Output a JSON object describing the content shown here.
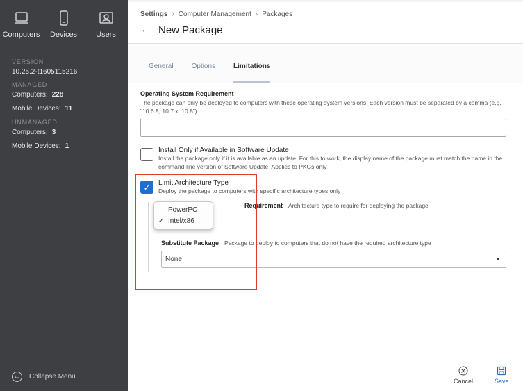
{
  "sidebar": {
    "nav": [
      {
        "label": "Computers",
        "icon": "laptop-icon"
      },
      {
        "label": "Devices",
        "icon": "phone-icon"
      },
      {
        "label": "Users",
        "icon": "user-id-icon"
      }
    ],
    "version_heading": "VERSION",
    "version": "10.25.2-t1605115216",
    "managed_heading": "MANAGED",
    "managed": [
      {
        "label": "Computers:",
        "count": "228"
      },
      {
        "label": "Mobile Devices:",
        "count": "11"
      }
    ],
    "unmanaged_heading": "UNMANAGED",
    "unmanaged": [
      {
        "label": "Computers:",
        "count": "3"
      },
      {
        "label": "Mobile Devices:",
        "count": "1"
      }
    ],
    "collapse_label": "Collapse Menu"
  },
  "header": {
    "breadcrumb": [
      "Settings",
      "Computer Management",
      "Packages"
    ],
    "title": "New Package"
  },
  "tabs": [
    "General",
    "Options",
    "Limitations"
  ],
  "active_tab": "Limitations",
  "os_requirement": {
    "label": "Operating System Requirement",
    "help": "The package can only be deployed to computers with these operating system versions. Each version must be separated by a comma (e.g. \"10.6.8, 10.7.x, 10.8\")",
    "value": ""
  },
  "software_update": {
    "label": "Install Only if Available in Software Update",
    "help": "Install the package only if it is available as an update. For this to work, the display name of the package must match the name in the command-line version of Software Update. Applies to PKGs only",
    "checked": false
  },
  "arch": {
    "label": "Limit Architecture Type",
    "help": "Deploy the package to computers with specific architecture types only",
    "checked": true,
    "req_label": "Requirement",
    "req_help": "Architecture type to require for deploying the package",
    "options": [
      "PowerPC",
      "Intel/x86"
    ],
    "selected": "Intel/x86",
    "substitute_label": "Substitute Package",
    "substitute_help": "Package to deploy to computers that do not have the required architecture type",
    "substitute_value": "None"
  },
  "actions": {
    "cancel": "Cancel",
    "save": "Save"
  },
  "colors": {
    "accent": "#1e6fd0",
    "highlight": "#e03a2a",
    "sidebar": "#3d3f42"
  }
}
